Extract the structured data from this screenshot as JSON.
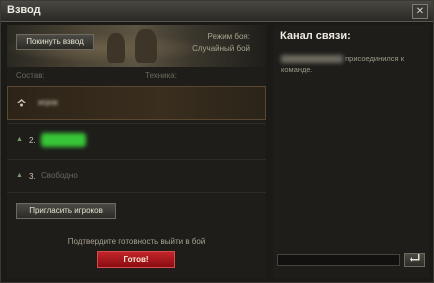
{
  "window": {
    "title": "Взвод",
    "close_label": "✕"
  },
  "left": {
    "leave_button": "Покинуть взвод",
    "battle_mode_label": "Режим боя:",
    "battle_mode_value": "Случайный бой",
    "headers": {
      "composition": "Состав:",
      "vehicle": "Техника:"
    },
    "slots": [
      {
        "number": "",
        "name": "игрок"
      },
      {
        "number": "2.",
        "name": ""
      },
      {
        "number": "3.",
        "name": "Свободно"
      }
    ],
    "invite_button": "Пригласить игроков",
    "confirm_text": "Подтвердите готовность выйти в бой",
    "ready_button": "Готов!"
  },
  "chat": {
    "title": "Канал связи:",
    "message": "присоединился к команде.",
    "send_icon": "enter-arrow-icon"
  },
  "colors": {
    "ready": "#b3191f",
    "player_highlight": "#37c637"
  }
}
